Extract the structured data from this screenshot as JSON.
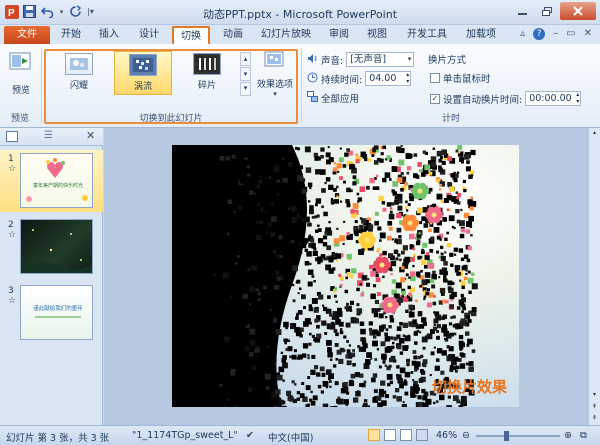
{
  "window": {
    "title": "动态PPT.pptx - Microsoft PowerPoint"
  },
  "tabs": [
    {
      "label": "文件"
    },
    {
      "label": "开始"
    },
    {
      "label": "插入"
    },
    {
      "label": "设计"
    },
    {
      "label": "切换"
    },
    {
      "label": "动画"
    },
    {
      "label": "幻灯片放映"
    },
    {
      "label": "审阅"
    },
    {
      "label": "视图"
    },
    {
      "label": "开发工具"
    },
    {
      "label": "加载项"
    }
  ],
  "ribbon": {
    "preview": {
      "button_label": "预览",
      "group_label": "预览"
    },
    "transitions": {
      "items": [
        {
          "label": "闪耀"
        },
        {
          "label": "涡流"
        },
        {
          "label": "碎片"
        }
      ],
      "effect_options_label": "效果选项",
      "group_label": "切换到此幻灯片"
    },
    "timing": {
      "sound_label": "声音:",
      "sound_value": "[无声音]",
      "duration_label": "持续时间:",
      "duration_value": "04.00",
      "apply_all_label": "全部应用",
      "advance_label": "换片方式",
      "on_click_label": "单击鼠标时",
      "after_label": "设置自动换片时间:",
      "after_value": "00:00.00",
      "group_label": "计时"
    }
  },
  "slides": [
    {
      "number": "1",
      "star": "☆",
      "title_text": "童年美产期的快乐时光"
    },
    {
      "number": "2",
      "star": "☆"
    },
    {
      "number": "3",
      "star": "☆",
      "title_text": "谨此献给我们的童年"
    }
  ],
  "current_slide": {
    "caption": "切换片效果"
  },
  "statusbar": {
    "slide_info": "幻灯片 第 3 张，共 3 张",
    "theme": "\"1_1174TGp_sweet_L\"",
    "language": "中文(中国)",
    "zoom": "46%"
  },
  "colors": {
    "accent_orange": "#e2792a",
    "file_tab": "#d35224",
    "caption": "#e8731d"
  }
}
